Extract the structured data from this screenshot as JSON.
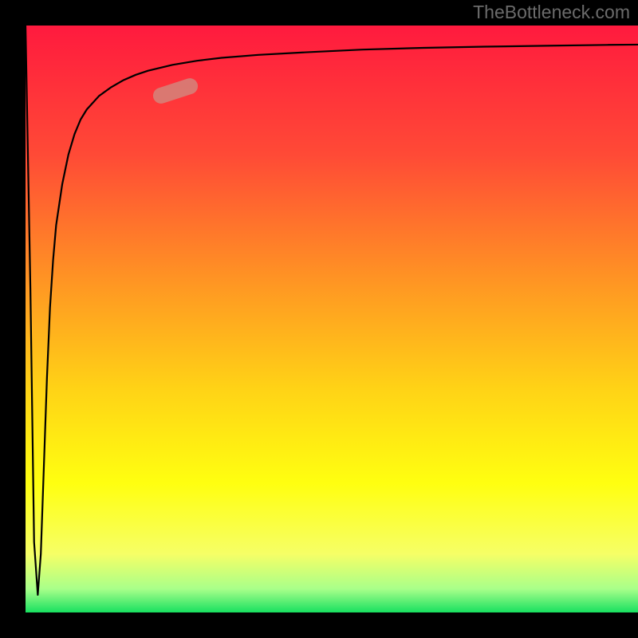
{
  "attribution": "TheBottleneck.com",
  "chart_data": {
    "type": "line",
    "title": "",
    "xlabel": "",
    "ylabel": "",
    "xlim": [
      0,
      100
    ],
    "ylim": [
      0,
      100
    ],
    "grid": false,
    "legend": false,
    "background_gradient": {
      "stops": [
        {
          "pos": 0.0,
          "color": "#ff1a3e"
        },
        {
          "pos": 0.22,
          "color": "#ff4a36"
        },
        {
          "pos": 0.45,
          "color": "#ff9a22"
        },
        {
          "pos": 0.62,
          "color": "#ffd316"
        },
        {
          "pos": 0.78,
          "color": "#ffff10"
        },
        {
          "pos": 0.9,
          "color": "#f6ff66"
        },
        {
          "pos": 0.96,
          "color": "#a8ff8a"
        },
        {
          "pos": 1.0,
          "color": "#18e060"
        }
      ]
    },
    "series": [
      {
        "name": "bottleneck-curve",
        "x": [
          0.0,
          0.8,
          1.4,
          2.0,
          2.5,
          3.0,
          3.5,
          4.0,
          4.5,
          5.0,
          6.0,
          7.0,
          8.0,
          9.0,
          10,
          12,
          14,
          16,
          18,
          20,
          24,
          28,
          32,
          38,
          45,
          55,
          65,
          75,
          85,
          95,
          100
        ],
        "y": [
          100,
          55,
          12,
          3,
          10,
          25,
          40,
          52,
          60,
          66,
          73,
          78,
          81.5,
          84,
          85.7,
          88,
          89.5,
          90.7,
          91.6,
          92.3,
          93.3,
          94.0,
          94.5,
          95.0,
          95.4,
          95.9,
          96.2,
          96.4,
          96.55,
          96.7,
          96.75
        ]
      }
    ],
    "marker": {
      "cx": 24.5,
      "cy": 88.8,
      "angle_deg": 18
    }
  }
}
